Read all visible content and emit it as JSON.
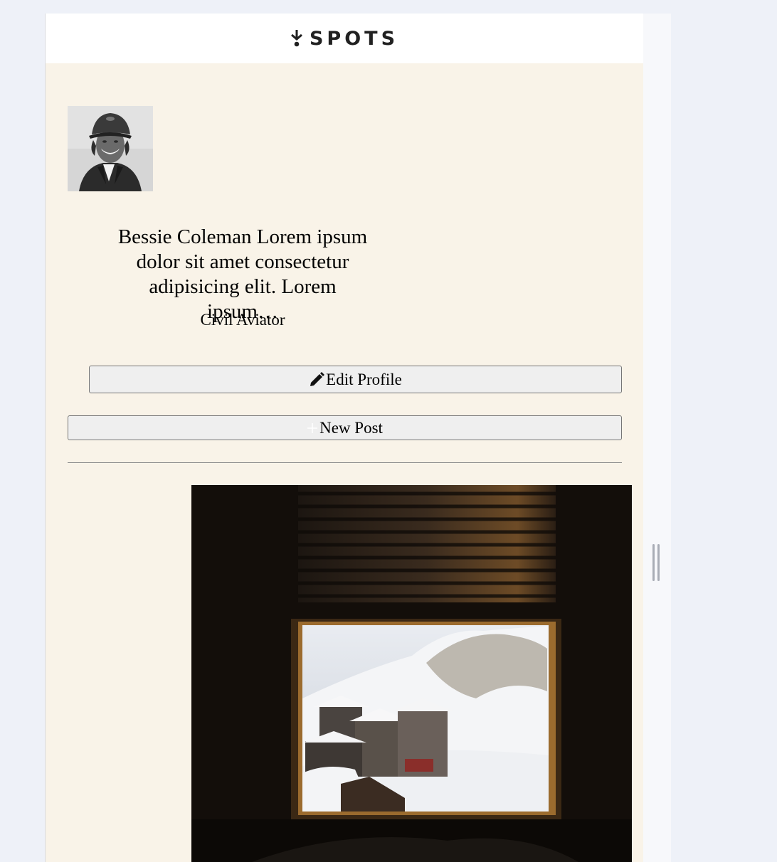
{
  "header": {
    "logo_text": "SPOTS",
    "logo_icon": "tree-icon"
  },
  "profile": {
    "avatar_icon": "avatar-photo",
    "bio": "Bessie Coleman Lorem ipsum dolor sit amet consectetur adipisicing elit. Lorem ipsum…",
    "job": "Civil Aviator"
  },
  "actions": {
    "edit_label": "Edit Profile",
    "edit_icon": "pencil-icon",
    "new_post_label": "New Post",
    "new_post_icon": "plus-icon"
  },
  "feed": {
    "post_image": "window-snow-village-photo"
  },
  "colors": {
    "page_background": "#f9f3e8",
    "header_background": "#ffffff",
    "button_background": "#efefef",
    "outer_background": "#eef1f8"
  }
}
